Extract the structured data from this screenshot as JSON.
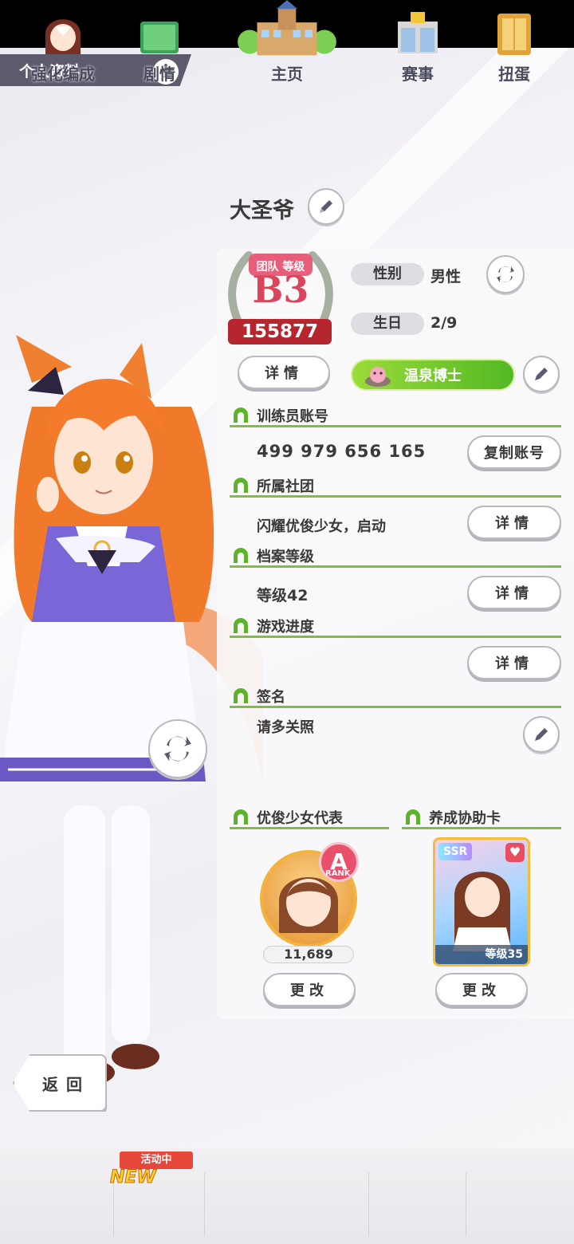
{
  "header": {
    "title": "个人资料",
    "info_icon": "info-icon"
  },
  "profile": {
    "name": "大圣爷",
    "team_rank": {
      "label": "团队 等级",
      "rank": "B3",
      "score": "155877"
    },
    "gender_label": "性别",
    "gender_value": "男性",
    "birthday_label": "生日",
    "birthday_value": "2/9",
    "detail_button": "详情",
    "title_banner": "温泉博士"
  },
  "sections": {
    "trainer_id": {
      "heading": "训练员账号",
      "value": "499 979 656 165",
      "button": "复制账号"
    },
    "club": {
      "heading": "所属社团",
      "value": "闪耀优俊少女，启动",
      "button": "详情"
    },
    "profile_level": {
      "heading": "档案等级",
      "value": "等级42",
      "button": "详情"
    },
    "progress": {
      "heading": "游戏进度",
      "button": "详情"
    },
    "signature": {
      "heading": "签名",
      "value": "请多关照"
    }
  },
  "representative": {
    "heading": "优俊少女代表",
    "rank": "A",
    "rank_sub": "RANK",
    "fans": "11,689",
    "button": "更改"
  },
  "support_card": {
    "heading": "养成协助卡",
    "rarity": "SSR",
    "level": "等级35",
    "button": "更改"
  },
  "back_button": "返回",
  "bottom_nav": {
    "items": [
      {
        "label": "强化编成"
      },
      {
        "label": "剧情"
      },
      {
        "label": "主页"
      },
      {
        "label": "赛事"
      },
      {
        "label": "扭蛋"
      }
    ],
    "event_tag": "活动中",
    "new_tag": "NEW"
  },
  "colors": {
    "accent_green": "#7cc239",
    "rank_red": "#b5262f",
    "tab_gray": "#5e5a6d"
  }
}
